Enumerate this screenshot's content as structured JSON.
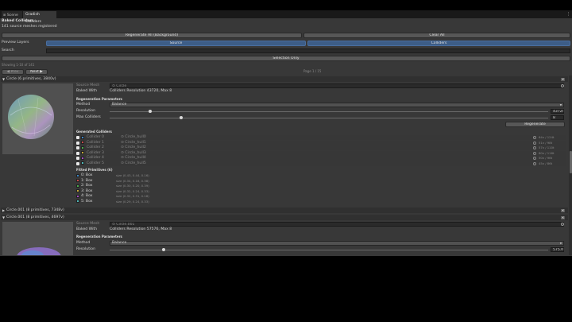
{
  "tabs": [
    {
      "label": "Scene",
      "active": false
    },
    {
      "label": "Gradish Colliders",
      "active": true
    }
  ],
  "header": {
    "title": "Baked Colliders",
    "subtitle": "141 source meshes registered"
  },
  "toolbar": {
    "regenerate_all_label": "Regenerate All (Background)",
    "clear_all_label": "Clear All",
    "preview_layers_label": "Preview Layers",
    "layer_source_label": "Source",
    "layer_colliders_label": "Colliders",
    "search_label": "Search",
    "search_value": "",
    "selection_only_label": "Selection Only"
  },
  "pager": {
    "showing": "Showing 1-10 of 141",
    "prev_label": "◀ Prev",
    "next_label": "Next ▶",
    "page": "Page 1 / 15"
  },
  "items": [
    {
      "header": "Circle  (6 primitives, 3840v)",
      "source_mesh_label": "Source Mesh",
      "source_mesh_value": "⊙ Circle",
      "baked_with_label": "Baked With",
      "baked_with_value": "Colliders Resolution 43720, Max 8",
      "regen_params_label": "Regeneration Parameters",
      "method_label": "Method",
      "method_value": "Balance",
      "resolution_label": "Resolution",
      "resolution_value": "43720",
      "resolution_fraction": 0.09,
      "max_colliders_label": "Max Colliders",
      "max_colliders_value": "8",
      "max_colliders_fraction": 0.16,
      "regenerate_label": "Regenerate",
      "generated_label": "Generated Colliders",
      "colliders": [
        {
          "name": "Collider 0",
          "mesh": "⊙ Circle_hull0",
          "stats": "64v / 124t",
          "color": "#3c86c6"
        },
        {
          "name": "Collider 1",
          "mesh": "⊙ Circle_hull1",
          "stats": "51v / 98t",
          "color": "#c64a4a"
        },
        {
          "name": "Collider 2",
          "mesh": "⊙ Circle_hull2",
          "stats": "57v / 110t",
          "color": "#4cae4c"
        },
        {
          "name": "Collider 3",
          "mesh": "⊙ Circle_hull3",
          "stats": "60v / 116t",
          "color": "#c4a637"
        },
        {
          "name": "Collider 4",
          "mesh": "⊙ Circle_hull4",
          "stats": "50v / 96t",
          "color": "#a54bc4"
        },
        {
          "name": "Collider 5",
          "mesh": "⊙ Circle_hull5",
          "stats": "45v / 86t",
          "color": "#4fb8b8"
        }
      ],
      "fitted_label": "Fitted Primitives (6)",
      "primitives": [
        {
          "name": "0: Box",
          "size": "size (0.43, 0.44, 0.16)",
          "color": "#3c86c6"
        },
        {
          "name": "1: Box",
          "size": "size (0.34, 0.18, 0.38)",
          "color": "#c64a4a"
        },
        {
          "name": "2: Box",
          "size": "size (0.30, 0.20, 0.39)",
          "color": "#4cae4c"
        },
        {
          "name": "3: Box",
          "size": "size (0.32, 0.24, 0.33)",
          "color": "#c4a637"
        },
        {
          "name": "4: Box",
          "size": "size (0.32, 0.31, 0.18)",
          "color": "#a54bc4"
        },
        {
          "name": "5: Box",
          "size": "size (0.29, 0.24, 0.33)",
          "color": "#4fb8b8"
        }
      ]
    },
    {
      "header": "Circle.001  (8 primitives, 7348v)"
    },
    {
      "header": "Circle.001  (8 primitives, 4697v)",
      "source_mesh_label": "Source Mesh",
      "source_mesh_value": "⊙ Circle.001",
      "baked_with_label": "Baked With",
      "baked_with_value": "Colliders Resolution 57576, Max 8",
      "regen_params_label": "Regeneration Parameters",
      "method_label": "Method",
      "method_value": "Balance",
      "resolution_label": "Resolution",
      "resolution_value": "57576",
      "resolution_fraction": 0.12
    }
  ]
}
